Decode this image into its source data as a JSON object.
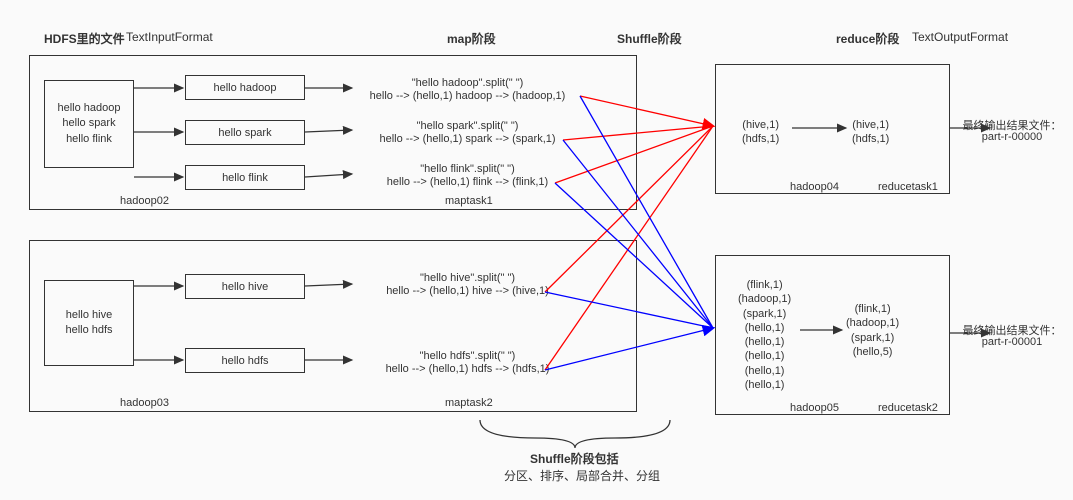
{
  "headers": {
    "hdfs": "HDFS里的文件",
    "input_format": "TextInputFormat",
    "map": "map阶段",
    "shuffle": "Shuffle阶段",
    "reduce": "reduce阶段",
    "output_format": "TextOutputFormat"
  },
  "file1": {
    "lines": [
      "hello hadoop",
      "hello spark",
      "hello flink"
    ],
    "node": "hadoop02"
  },
  "file2": {
    "lines": [
      "hello hive",
      "hello hdfs"
    ],
    "node": "hadoop03"
  },
  "splits1": [
    "hello hadoop",
    "hello spark",
    "hello flink"
  ],
  "splits2": [
    "hello hive",
    "hello hdfs"
  ],
  "map1": {
    "ops": [
      {
        "title": "\"hello hadoop\".split(\" \")",
        "detail": "hello --> (hello,1) hadoop --> (hadoop,1)"
      },
      {
        "title": "\"hello spark\".split(\" \")",
        "detail": "hello --> (hello,1) spark --> (spark,1)"
      },
      {
        "title": "\"hello flink\".split(\" \")",
        "detail": "hello --> (hello,1) flink --> (flink,1)"
      }
    ],
    "task": "maptask1"
  },
  "map2": {
    "ops": [
      {
        "title": "\"hello hive\".split(\" \")",
        "detail": "hello --> (hello,1) hive --> (hive,1)"
      },
      {
        "title": "\"hello hdfs\".split(\" \")",
        "detail": "hello --> (hello,1) hdfs --> (hdfs,1)"
      }
    ],
    "task": "maptask2"
  },
  "reduce1": {
    "in": [
      "(hive,1)",
      "(hdfs,1)"
    ],
    "out": [
      "(hive,1)",
      "(hdfs,1)"
    ],
    "node": "hadoop04",
    "task": "reducetask1",
    "out_file_label": "最终输出结果文件：",
    "out_file": "part-r-00000"
  },
  "reduce2": {
    "in": [
      "(flink,1)",
      "(hadoop,1)",
      "(spark,1)",
      "(hello,1)",
      "(hello,1)",
      "(hello,1)",
      "(hello,1)",
      "(hello,1)"
    ],
    "out": [
      "(flink,1)",
      "(hadoop,1)",
      "(spark,1)",
      "(hello,5)"
    ],
    "node": "hadoop05",
    "task": "reducetask2",
    "out_file_label": "最终输出结果文件：",
    "out_file": "part-r-00001"
  },
  "shuffle_desc": {
    "title": "Shuffle阶段包括",
    "sub": "分区、排序、局部合并、分组"
  }
}
